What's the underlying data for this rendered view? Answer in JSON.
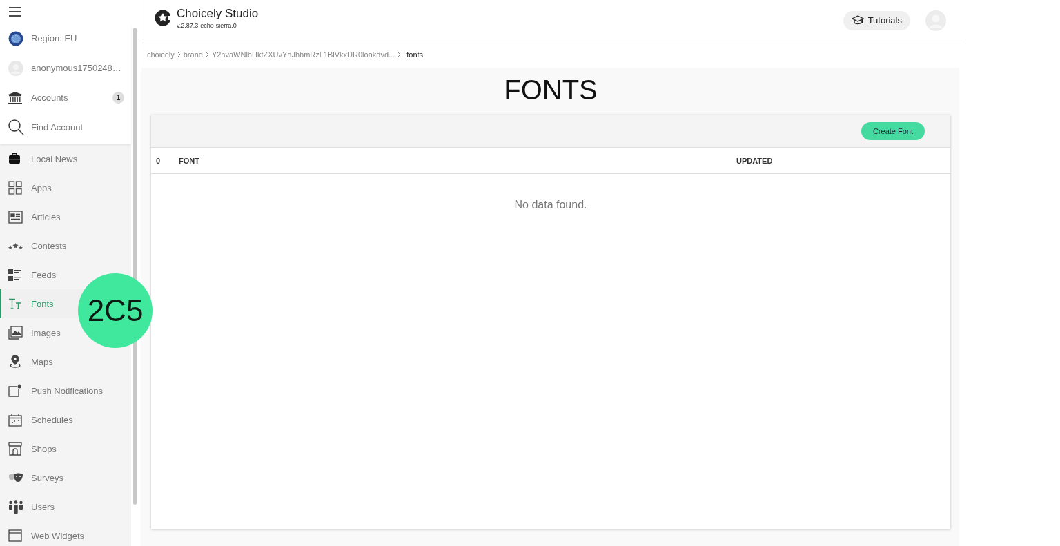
{
  "sidebar": {
    "account_items": [
      {
        "label": "Region: EU",
        "selected": false
      },
      {
        "label": "anonymous1750248…",
        "selected": false
      },
      {
        "label": "Accounts",
        "count": "1",
        "selected": false
      },
      {
        "label": "Find Account",
        "selected": false
      }
    ],
    "items": [
      {
        "label": "Local News",
        "selected": false
      },
      {
        "label": "Apps",
        "selected": false
      },
      {
        "label": "Articles",
        "selected": false
      },
      {
        "label": "Contests",
        "selected": false
      },
      {
        "label": "Feeds",
        "selected": false
      },
      {
        "label": "Fonts",
        "selected": true
      },
      {
        "label": "Images",
        "selected": false
      },
      {
        "label": "Maps",
        "selected": false
      },
      {
        "label": "Push Notifications",
        "selected": false
      },
      {
        "label": "Schedules",
        "selected": false
      },
      {
        "label": "Shops",
        "selected": false
      },
      {
        "label": "Surveys",
        "selected": false
      },
      {
        "label": "Users",
        "selected": false
      },
      {
        "label": "Web Widgets",
        "selected": false
      }
    ]
  },
  "header": {
    "app_title": "Choicely Studio",
    "version": "v.2.87.3-echo-sierra.0",
    "tutorials_button": "Tutorials"
  },
  "breadcrumb": [
    "choicely",
    "brand",
    "Y2hvaWNlbHktZXUvYnJhbmRzL1BlVkxDR0loakdvd...",
    "fonts"
  ],
  "page_title": "FONTS",
  "table": {
    "create_button": "Create Font",
    "count": "0",
    "columns": [
      "FONT",
      "UPDATED"
    ],
    "empty_message": "No data found."
  },
  "annotation": {
    "label": "2C5"
  }
}
